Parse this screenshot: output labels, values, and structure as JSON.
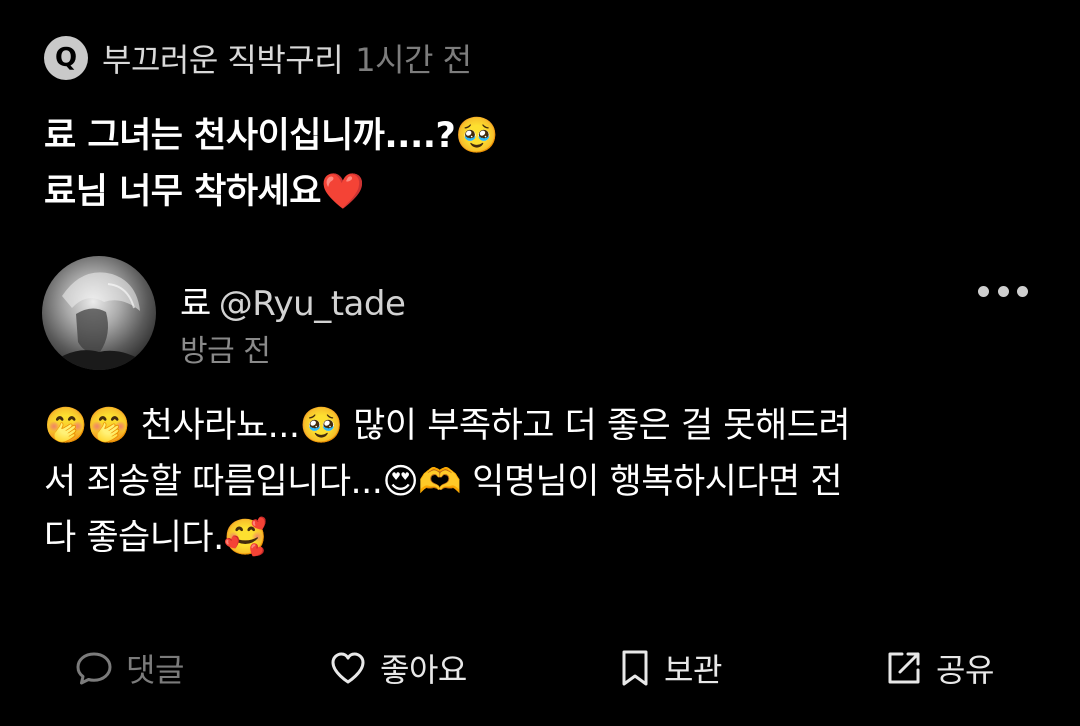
{
  "question": {
    "badge": "Q",
    "asker": "부끄러운 직박구리",
    "time": "1시간 전",
    "lines": [
      "료 그녀는 천사이십니까....?🥹",
      "료님 너무 착하세요❤️"
    ]
  },
  "answer": {
    "author_name": "료",
    "author_handle": "@Ryu_tade",
    "posted": "방금 전",
    "lines": [
      "🤭🤭 천사라뇨...🥹 많이 부족하고 더 좋은 걸 못해드려",
      "서 죄송할 따름입니다...😍🫶 익명님이 행복하시다면 전",
      "다 좋습니다.🥰"
    ]
  },
  "actions": {
    "comment": "댓글",
    "like": "좋아요",
    "save": "보관",
    "share": "공유"
  },
  "icons": {
    "more": "more-dots-icon",
    "comment": "speech-bubble-icon",
    "like": "heart-icon",
    "save": "bookmark-icon",
    "share": "share-arrow-icon"
  }
}
